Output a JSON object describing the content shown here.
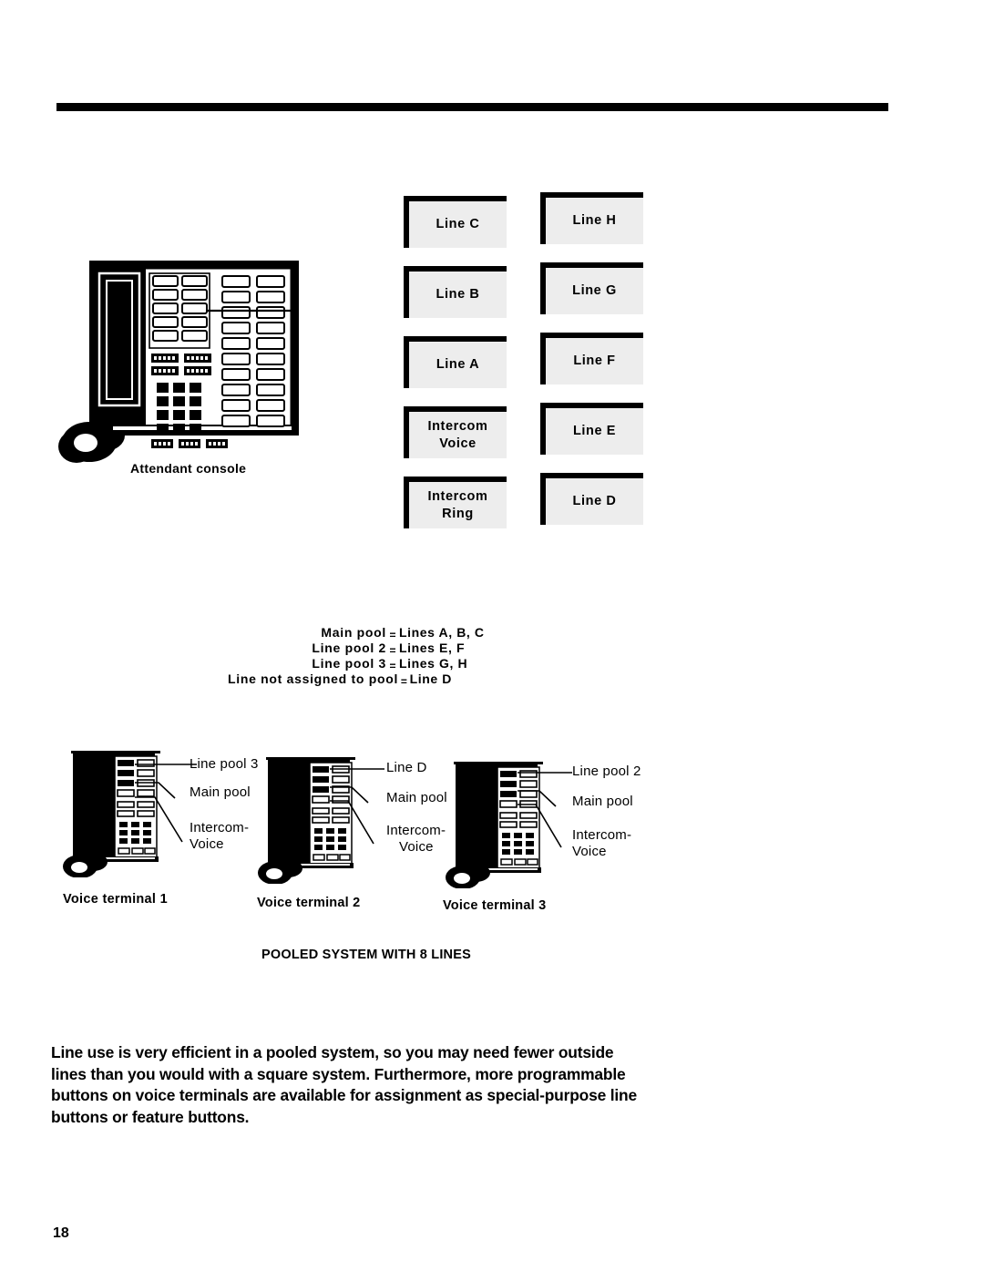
{
  "page": {
    "number": "18"
  },
  "diagram": {
    "console_label": "Attendant  console",
    "system_caption": "POOLED SYSTEM WITH 8 LINES",
    "line_boxes_left": [
      {
        "label": "Line  C"
      },
      {
        "label": "Line  B"
      },
      {
        "label": "Line  A"
      },
      {
        "label_line1": "Intercom",
        "label_line2": "Voice"
      },
      {
        "label_line1": "Intercom",
        "label_line2": "Ring"
      }
    ],
    "line_boxes_right": [
      {
        "label": "Line  H"
      },
      {
        "label": "Line  G"
      },
      {
        "label": "Line  F"
      },
      {
        "label": "Line  E"
      },
      {
        "label": "Line  D"
      }
    ],
    "pool_assignments": [
      {
        "left": "Main  pool",
        "eq": "=",
        "right": "Lines A, B, C"
      },
      {
        "left": "Line  pool  2",
        "eq": "=",
        "right": "Lines E, F"
      },
      {
        "left": "Line  pool  3",
        "eq": "=",
        "right": "Lines G, H"
      },
      {
        "left": "Line  not  assigned  to  pool",
        "eq": "=",
        "right": "Line D"
      }
    ],
    "terminals": [
      {
        "caption": "Voice  terminal  1",
        "callouts": [
          "Line pool 3",
          "Main  pool",
          "Intercom-",
          "Voice"
        ]
      },
      {
        "caption": "Voice terminal 2",
        "callouts": [
          "Line D",
          "Main pool",
          "Intercom-",
          "Voice"
        ]
      },
      {
        "caption": "Voice terminal 3",
        "callouts": [
          "Line  pool  2",
          "Main  pool",
          "Intercom-",
          "Voice"
        ]
      }
    ]
  },
  "body": {
    "paragraph": "Line use is very efficient in a pooled system, so you may need fewer outside lines than you would with a square system. Furthermore, more programmable buttons on voice terminals are available for assignment as special-purpose line buttons or feature buttons."
  },
  "colors": {
    "box_fill": "#ededed",
    "ink": "#000000",
    "paper": "#ffffff"
  }
}
